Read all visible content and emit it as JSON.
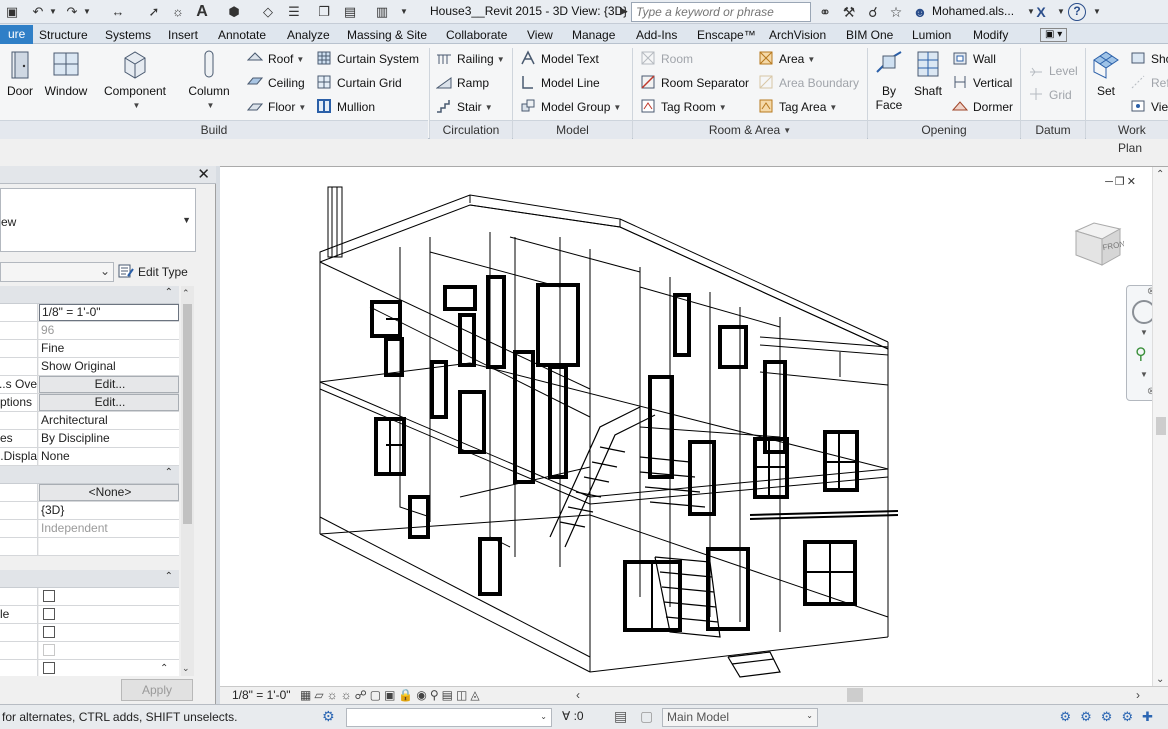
{
  "titlebar": {
    "doc_title": "House3__Revit 2015 - 3D View: {3D}",
    "search_placeholder": "Type a keyword or phrase",
    "user_name": "Mohamed.als...",
    "help_label": "?",
    "exchange_label": "X"
  },
  "tabs": [
    {
      "label": "ure",
      "active": true
    },
    {
      "label": "Structure"
    },
    {
      "label": "Systems"
    },
    {
      "label": "Insert"
    },
    {
      "label": "Annotate"
    },
    {
      "label": "Analyze"
    },
    {
      "label": "Massing & Site"
    },
    {
      "label": "Collaborate"
    },
    {
      "label": "View"
    },
    {
      "label": "Manage"
    },
    {
      "label": "Add-Ins"
    },
    {
      "label": "Enscape™"
    },
    {
      "label": "ArchVision"
    },
    {
      "label": "BIM One"
    },
    {
      "label": "Lumion"
    },
    {
      "label": "Modify"
    }
  ],
  "ribbon": {
    "build": {
      "door": "Door",
      "window": "Window",
      "component": "Component",
      "column": "Column",
      "roof": "Roof",
      "ceiling": "Ceiling",
      "floor": "Floor",
      "curtain_system": "Curtain System",
      "curtain_grid": "Curtain Grid",
      "mullion": "Mullion",
      "footer": "Build"
    },
    "circulation": {
      "railing": "Railing",
      "ramp": "Ramp",
      "stair": "Stair",
      "footer": "Circulation"
    },
    "model": {
      "model_text": "Model Text",
      "model_line": "Model Line",
      "model_group": "Model Group",
      "footer": "Model"
    },
    "room_area": {
      "room": "Room",
      "room_separator": "Room Separator",
      "tag_room": "Tag Room",
      "area": "Area",
      "area_boundary": "Area Boundary",
      "tag_area": "Tag Area",
      "footer": "Room & Area"
    },
    "opening": {
      "by_face_1": "By",
      "by_face_2": "Face",
      "shaft": "Shaft",
      "wall": "Wall",
      "vertical": "Vertical",
      "dormer": "Dormer",
      "footer": "Opening"
    },
    "datum": {
      "level": "Level",
      "grid": "Grid",
      "footer": "Datum"
    },
    "work_plane": {
      "set": "Set",
      "show": "Sho",
      "ref": "Ref",
      "viewer": "View",
      "footer": "Work Plan"
    }
  },
  "properties": {
    "close_label": "✕",
    "type_selector_label": "ew",
    "edit_type_label": "Edit Type",
    "rows": [
      {
        "name": "",
        "value": "1/8\" = 1'-0\"",
        "style": "boxed"
      },
      {
        "name": "",
        "value": "96",
        "style": "grey"
      },
      {
        "name": "",
        "value": "Fine"
      },
      {
        "name": "",
        "value": "Show Original"
      },
      {
        "name": "s Ove...",
        "value": "Edit...",
        "style": "btn"
      },
      {
        "name": "ptions",
        "value": "Edit...",
        "style": "btn"
      },
      {
        "name": "",
        "value": "Architectural"
      },
      {
        "name": "es",
        "value": "By Discipline"
      },
      {
        "name": "Displa...",
        "value": "None"
      },
      {
        "group": true
      },
      {
        "name": "",
        "value": "<None>",
        "style": "btn"
      },
      {
        "name": "",
        "value": "{3D}"
      },
      {
        "name": "",
        "value": "Independent",
        "style": "grey"
      },
      {
        "name": "",
        "value": ""
      },
      {
        "group": true
      },
      {
        "name": "",
        "value": "",
        "check": true
      },
      {
        "name": "le",
        "value": "",
        "check": true
      },
      {
        "name": "",
        "value": "",
        "check": true
      },
      {
        "name": "",
        "value": "",
        "check": "disabled"
      },
      {
        "name": "",
        "value": "",
        "check": true
      }
    ],
    "apply_label": "Apply"
  },
  "view": {
    "viewcube_label": "FRONT",
    "view_scale": "1/8\" = 1'-0\""
  },
  "statusbar": {
    "text": "for alternates, CTRL adds, SHIFT unselects.",
    "count": ":0",
    "main_model": "Main Model"
  }
}
